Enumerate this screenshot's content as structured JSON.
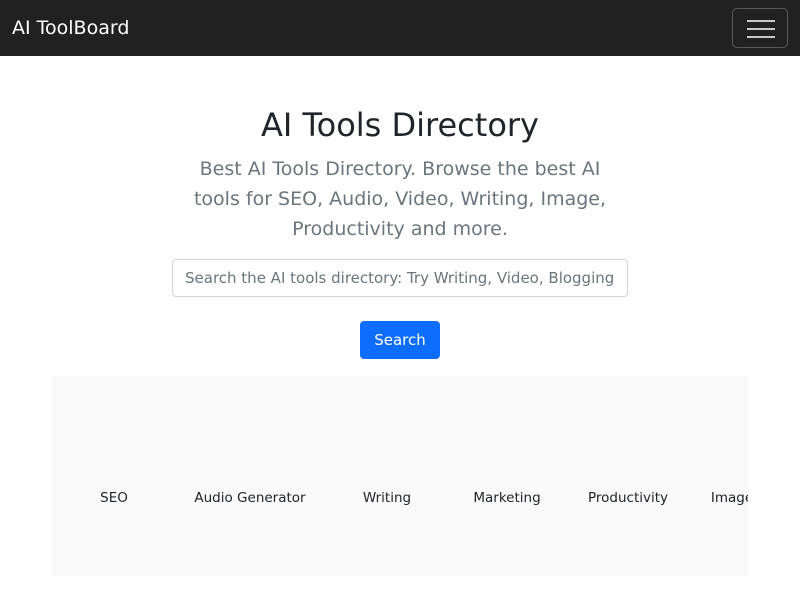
{
  "navbar": {
    "brand": "AI ToolBoard",
    "toggler_icon": "hamburger-menu-icon"
  },
  "hero": {
    "title": "AI Tools Directory",
    "subtitle": "Best AI Tools Directory. Browse the best AI tools for SEO, Audio, Video, Writing, Image, Productivity and more."
  },
  "search": {
    "placeholder": "Search the AI tools directory: Try Writing, Video, Blogging",
    "value": "",
    "button_label": "Search"
  },
  "categories": [
    "SEO",
    "Audio Generator",
    "Writing",
    "Marketing",
    "Productivity",
    "Image"
  ],
  "colors": {
    "navbar_bg": "#212121",
    "primary": "#0d6efd",
    "muted_text": "#6c757d",
    "strip_bg": "#f9f9f9"
  }
}
